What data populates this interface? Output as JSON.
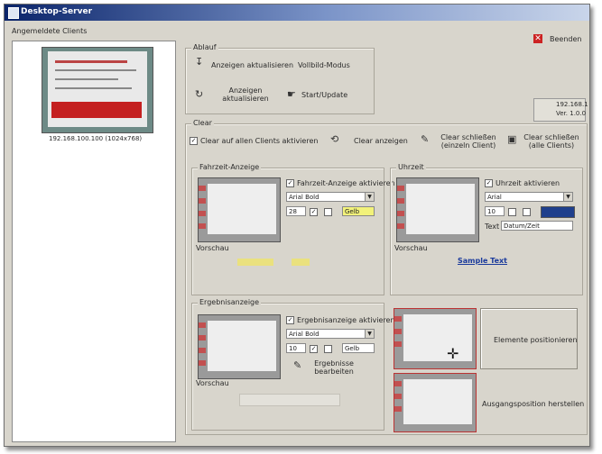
{
  "window": {
    "title": "Desktop-Server"
  },
  "left_panel": {
    "label": "Angemeldete Clients",
    "thumb_caption": "192.168.100.100 (1024x768)"
  },
  "beenden_label": "Beenden",
  "ablauf": {
    "title": "Ablauf",
    "btn_aktualisieren": "Anzeigen aktualisieren",
    "btn_vollbild": "Vollbild-Modus",
    "btn_neu": "Anzeigen aktualisieren",
    "btn_start": "Start/Update"
  },
  "status": {
    "line1": "192.168.1",
    "line2": "Ver. 1.0.0"
  },
  "clear": {
    "title": "Clear",
    "checkbox_label": "Clear auf allen Clients aktivieren",
    "btn_clear": "Clear anzeigen",
    "btn_hide1": "Clear schließen (einzeln Client)",
    "btn_hide2": "Clear schließen (alle Clients)"
  },
  "fahrzeit": {
    "title": "Fahrzeit-Anzeige",
    "checkbox_label": "Fahrzeit-Anzeige aktivieren",
    "font": "Arial Bold",
    "size": "28",
    "color_label": "Gelb",
    "preview_label": "Vorschau"
  },
  "uhrzeit": {
    "title": "Uhrzeit",
    "checkbox_label": "Uhrzeit aktivieren",
    "font": "Arial",
    "size": "10",
    "field_label": "Text",
    "field_value": "Datum/Zeit",
    "preview_label": "Vorschau",
    "preview_link": "Sample Text"
  },
  "ergebnis": {
    "title": "Ergebnisanzeige",
    "checkbox_label": "Ergebnisanzeige aktivieren",
    "font": "Arial Bold",
    "size": "10",
    "color_label": "Gelb",
    "btn_label": "Ergebnisse bearbeiten",
    "preview_label": "Vorschau"
  },
  "right_buttons": {
    "btn_position": "Elemente positionieren",
    "btn_reset": "Ausgangsposition herstellen"
  }
}
